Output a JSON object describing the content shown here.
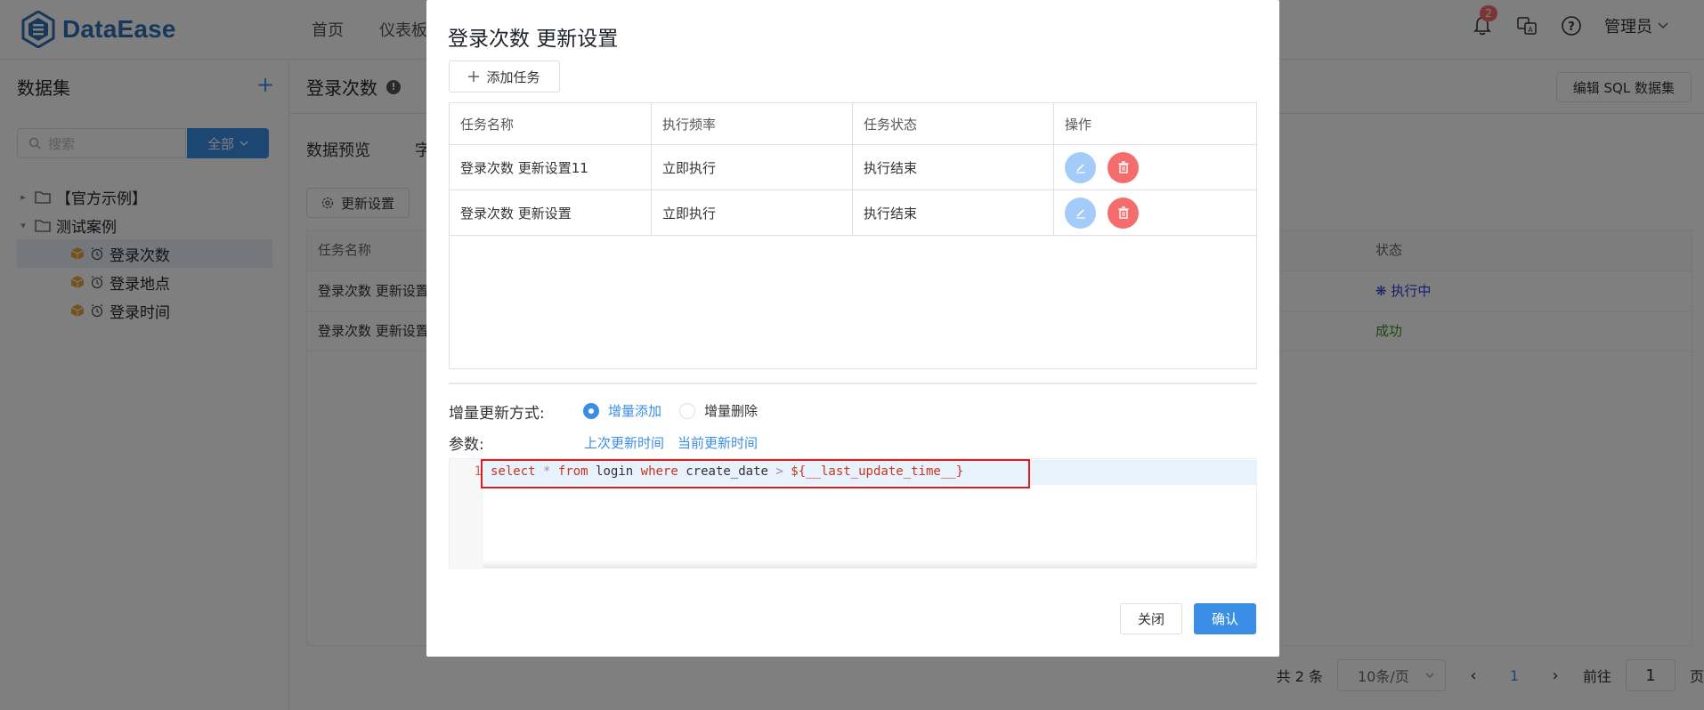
{
  "app": {
    "name": "DataEase"
  },
  "nav": {
    "items": [
      "首页",
      "仪表板"
    ]
  },
  "header": {
    "notification_count": "2",
    "user": "管理员"
  },
  "sidebar": {
    "title": "数据集",
    "search_placeholder": "搜索",
    "filter_label": "全部",
    "tree": [
      {
        "label": "【官方示例】",
        "type": "folder",
        "expanded": false
      },
      {
        "label": "测试案例",
        "type": "folder",
        "expanded": true
      },
      {
        "label": "登录次数",
        "type": "dataset",
        "active": true
      },
      {
        "label": "登录地点",
        "type": "dataset"
      },
      {
        "label": "登录时间",
        "type": "dataset"
      }
    ]
  },
  "main": {
    "title": "登录次数",
    "edit_sql_label": "编辑 SQL 数据集",
    "tabs": [
      "数据预览",
      "字"
    ],
    "update_settings_label": "更新设置",
    "table": {
      "col_name": "任务名称",
      "col_status": "状态",
      "rows": [
        {
          "name": "登录次数 更新设置",
          "status": "执行中"
        },
        {
          "name": "登录次数 更新设置",
          "status": "成功"
        }
      ]
    },
    "pager": {
      "total": "共 2 条",
      "page_size": "10条/页",
      "current_page": "1",
      "goto_label": "前往",
      "goto_value": "1",
      "page_suffix": "页"
    }
  },
  "dialog": {
    "title": "登录次数 更新设置",
    "add_task_label": "添加任务",
    "table": {
      "headers": [
        "任务名称",
        "执行频率",
        "任务状态",
        "操作"
      ],
      "rows": [
        {
          "name": "登录次数 更新设置11",
          "frequency": "立即执行",
          "status": "执行结束"
        },
        {
          "name": "登录次数 更新设置",
          "frequency": "立即执行",
          "status": "执行结束"
        }
      ]
    },
    "incremental": {
      "label": "增量更新方式:",
      "options": [
        "增量添加",
        "增量删除"
      ],
      "selected": "增量添加"
    },
    "params": {
      "label": "参数:",
      "links": [
        "上次更新时间",
        "当前更新时间"
      ]
    },
    "editor": {
      "line_number": "1",
      "kw_select": "select",
      "star": "*",
      "kw_from": "from",
      "table": "login",
      "kw_where": "where",
      "column": "create_date",
      "operator": ">",
      "template": "${__last_update_time__}"
    },
    "close_label": "关闭",
    "confirm_label": "确认"
  },
  "colors": {
    "primary": "#3a8ee6",
    "danger": "#f56c6c",
    "edit_button": "#a3cdf8",
    "highlight_box": "#e11b1b"
  }
}
